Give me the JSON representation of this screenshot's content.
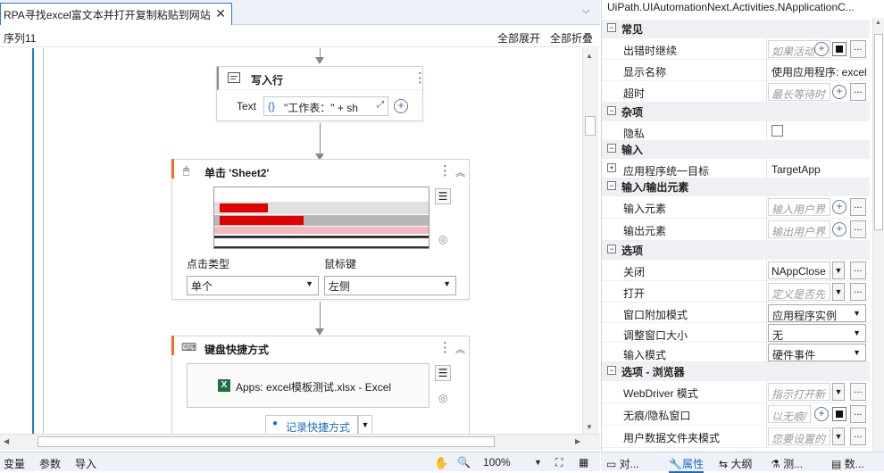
{
  "tab": {
    "title": "RPA寻找excel富文本并打开复制粘贴到网站",
    "close": "✕"
  },
  "breadcrumb": "序列11",
  "canvas_actions": {
    "expand_all": "全部展开",
    "collapse_all": "全部折叠"
  },
  "write_line": {
    "title": "写入行",
    "text_label": "Text",
    "expr_icon": "{}",
    "text_value": "\"工作表：\" + sh"
  },
  "click": {
    "title": "单击 'Sheet2'",
    "click_type_label": "点击类型",
    "click_type_value": "单个",
    "mouse_button_label": "鼠标键",
    "mouse_button_value": "左侧"
  },
  "shortcut": {
    "title": "键盘快捷方式",
    "target_app": "Apps: excel模板测试.xlsx - Excel",
    "record_button": "记录快捷方式"
  },
  "status": {
    "vars": "变量",
    "args": "参数",
    "imports": "导入",
    "zoom": "100%"
  },
  "panel": {
    "title": "UiPath.UIAutomationNext.Activities.NApplicationC...",
    "groups": {
      "common": "常见",
      "misc": "杂项",
      "input": "输入",
      "io": "输入/输出元素",
      "options": "选项",
      "browser": "选项 - 浏览器"
    },
    "rows": {
      "continue_on_error": {
        "name": "出错时继续",
        "placeholder": "如果活动"
      },
      "display_name": {
        "name": "显示名称",
        "value": "使用应用程序: excel"
      },
      "timeout": {
        "name": "超时",
        "placeholder": "最长等待时"
      },
      "private": {
        "name": "隐私"
      },
      "app_target": {
        "name": "应用程序统一目标",
        "value": "TargetApp"
      },
      "input_element": {
        "name": "输入元素",
        "placeholder": "输入用户界"
      },
      "output_element": {
        "name": "输出元素",
        "placeholder": "输出用户界"
      },
      "close": {
        "name": "关闭",
        "value": "NAppClose"
      },
      "open": {
        "name": "打开",
        "placeholder": "定义是否先"
      },
      "attach_mode": {
        "name": "窗口附加模式",
        "value": "应用程序实例"
      },
      "resize": {
        "name": "调整窗口大小",
        "value": "无"
      },
      "input_mode": {
        "name": "输入模式",
        "value": "硬件事件"
      },
      "webdriver": {
        "name": "WebDriver 模式",
        "placeholder": "指示打开新"
      },
      "incognito": {
        "name": "无痕/隐私窗口",
        "placeholder": "以无痕/"
      },
      "user_data": {
        "name": "用户数据文件夹模式",
        "placeholder": "您要设置的"
      }
    }
  },
  "bottom_tabs": {
    "object": "对...",
    "properties": "属性",
    "outline": "大纲",
    "test": "测...",
    "data": "数..."
  },
  "colors": {
    "accent": "#1b7fc9",
    "active_tab": "#2d7be5",
    "excel_green": "#1d7044",
    "activity_bar": "#e8702a"
  }
}
